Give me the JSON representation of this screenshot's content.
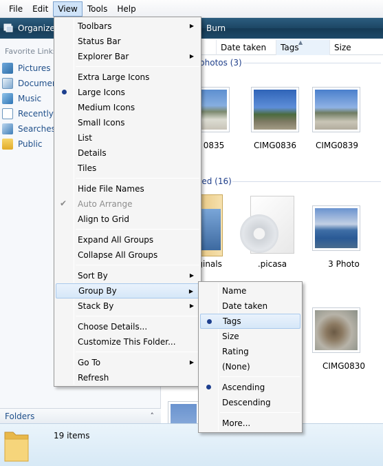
{
  "menubar": {
    "file": "File",
    "edit": "Edit",
    "view": "View",
    "tools": "Tools",
    "help": "Help"
  },
  "toolbar": {
    "organize_label": "Organize",
    "burn_label": "Burn"
  },
  "nav": {
    "favorites_title": "Favorite Links",
    "items": [
      {
        "label": "Pictures",
        "icon": "pictures-icon"
      },
      {
        "label": "Documents",
        "icon": "documents-icon"
      },
      {
        "label": "Music",
        "icon": "music-icon"
      },
      {
        "label": "Recently Changed",
        "icon": "recent-icon"
      },
      {
        "label": "Searches",
        "icon": "searches-icon"
      },
      {
        "label": "Public",
        "icon": "public-folder-icon"
      }
    ],
    "folders_label": "Folders"
  },
  "columns": {
    "date_taken": "Date taken",
    "tags": "Tags",
    "size": "Size"
  },
  "content": {
    "group1_header": "photos (3)",
    "group2_header": "ied (16)",
    "items": [
      {
        "caption": "0835"
      },
      {
        "caption": "CIMG0836"
      },
      {
        "caption": "CIMG0839"
      },
      {
        "caption": "riginals"
      },
      {
        "caption": ".picasa"
      },
      {
        "caption": "3 Photo"
      },
      {
        "caption": "CIMG0830"
      }
    ]
  },
  "status": {
    "count": "19 items"
  },
  "view_menu": {
    "toolbars": "Toolbars",
    "status_bar": "Status Bar",
    "explorer_bar": "Explorer Bar",
    "extra_large_icons": "Extra Large Icons",
    "large_icons": "Large Icons",
    "medium_icons": "Medium Icons",
    "small_icons": "Small Icons",
    "list": "List",
    "details": "Details",
    "tiles": "Tiles",
    "hide_file_names": "Hide File Names",
    "auto_arrange": "Auto Arrange",
    "align_to_grid": "Align to Grid",
    "expand_all_groups": "Expand All Groups",
    "collapse_all_groups": "Collapse All Groups",
    "sort_by": "Sort By",
    "group_by": "Group By",
    "stack_by": "Stack By",
    "choose_details": "Choose Details...",
    "customize_folder": "Customize This Folder...",
    "go_to": "Go To",
    "refresh": "Refresh"
  },
  "group_by_menu": {
    "name": "Name",
    "date_taken": "Date taken",
    "tags": "Tags",
    "size": "Size",
    "rating": "Rating",
    "none": "(None)",
    "ascending": "Ascending",
    "descending": "Descending",
    "more": "More..."
  }
}
